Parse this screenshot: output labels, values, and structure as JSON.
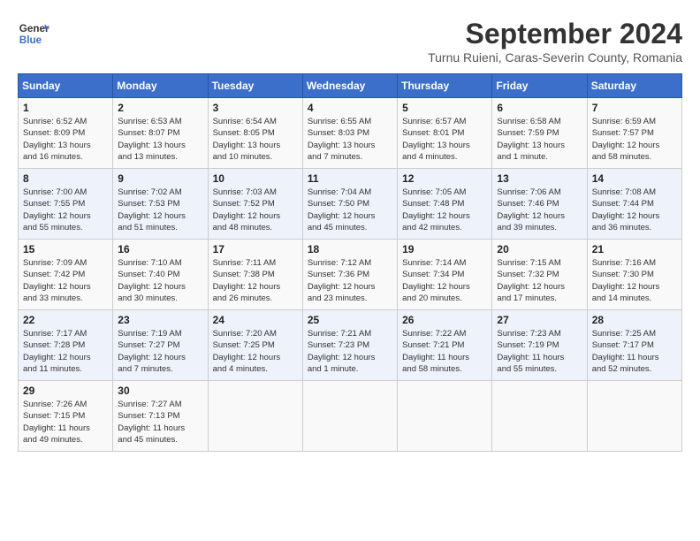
{
  "header": {
    "logo_line1": "General",
    "logo_line2": "Blue",
    "title": "September 2024",
    "subtitle": "Turnu Ruieni, Caras-Severin County, Romania"
  },
  "weekdays": [
    "Sunday",
    "Monday",
    "Tuesday",
    "Wednesday",
    "Thursday",
    "Friday",
    "Saturday"
  ],
  "weeks": [
    [
      {
        "day": "1",
        "info": "Sunrise: 6:52 AM\nSunset: 8:09 PM\nDaylight: 13 hours\nand 16 minutes."
      },
      {
        "day": "2",
        "info": "Sunrise: 6:53 AM\nSunset: 8:07 PM\nDaylight: 13 hours\nand 13 minutes."
      },
      {
        "day": "3",
        "info": "Sunrise: 6:54 AM\nSunset: 8:05 PM\nDaylight: 13 hours\nand 10 minutes."
      },
      {
        "day": "4",
        "info": "Sunrise: 6:55 AM\nSunset: 8:03 PM\nDaylight: 13 hours\nand 7 minutes."
      },
      {
        "day": "5",
        "info": "Sunrise: 6:57 AM\nSunset: 8:01 PM\nDaylight: 13 hours\nand 4 minutes."
      },
      {
        "day": "6",
        "info": "Sunrise: 6:58 AM\nSunset: 7:59 PM\nDaylight: 13 hours\nand 1 minute."
      },
      {
        "day": "7",
        "info": "Sunrise: 6:59 AM\nSunset: 7:57 PM\nDaylight: 12 hours\nand 58 minutes."
      }
    ],
    [
      {
        "day": "8",
        "info": "Sunrise: 7:00 AM\nSunset: 7:55 PM\nDaylight: 12 hours\nand 55 minutes."
      },
      {
        "day": "9",
        "info": "Sunrise: 7:02 AM\nSunset: 7:53 PM\nDaylight: 12 hours\nand 51 minutes."
      },
      {
        "day": "10",
        "info": "Sunrise: 7:03 AM\nSunset: 7:52 PM\nDaylight: 12 hours\nand 48 minutes."
      },
      {
        "day": "11",
        "info": "Sunrise: 7:04 AM\nSunset: 7:50 PM\nDaylight: 12 hours\nand 45 minutes."
      },
      {
        "day": "12",
        "info": "Sunrise: 7:05 AM\nSunset: 7:48 PM\nDaylight: 12 hours\nand 42 minutes."
      },
      {
        "day": "13",
        "info": "Sunrise: 7:06 AM\nSunset: 7:46 PM\nDaylight: 12 hours\nand 39 minutes."
      },
      {
        "day": "14",
        "info": "Sunrise: 7:08 AM\nSunset: 7:44 PM\nDaylight: 12 hours\nand 36 minutes."
      }
    ],
    [
      {
        "day": "15",
        "info": "Sunrise: 7:09 AM\nSunset: 7:42 PM\nDaylight: 12 hours\nand 33 minutes."
      },
      {
        "day": "16",
        "info": "Sunrise: 7:10 AM\nSunset: 7:40 PM\nDaylight: 12 hours\nand 30 minutes."
      },
      {
        "day": "17",
        "info": "Sunrise: 7:11 AM\nSunset: 7:38 PM\nDaylight: 12 hours\nand 26 minutes."
      },
      {
        "day": "18",
        "info": "Sunrise: 7:12 AM\nSunset: 7:36 PM\nDaylight: 12 hours\nand 23 minutes."
      },
      {
        "day": "19",
        "info": "Sunrise: 7:14 AM\nSunset: 7:34 PM\nDaylight: 12 hours\nand 20 minutes."
      },
      {
        "day": "20",
        "info": "Sunrise: 7:15 AM\nSunset: 7:32 PM\nDaylight: 12 hours\nand 17 minutes."
      },
      {
        "day": "21",
        "info": "Sunrise: 7:16 AM\nSunset: 7:30 PM\nDaylight: 12 hours\nand 14 minutes."
      }
    ],
    [
      {
        "day": "22",
        "info": "Sunrise: 7:17 AM\nSunset: 7:28 PM\nDaylight: 12 hours\nand 11 minutes."
      },
      {
        "day": "23",
        "info": "Sunrise: 7:19 AM\nSunset: 7:27 PM\nDaylight: 12 hours\nand 7 minutes."
      },
      {
        "day": "24",
        "info": "Sunrise: 7:20 AM\nSunset: 7:25 PM\nDaylight: 12 hours\nand 4 minutes."
      },
      {
        "day": "25",
        "info": "Sunrise: 7:21 AM\nSunset: 7:23 PM\nDaylight: 12 hours\nand 1 minute."
      },
      {
        "day": "26",
        "info": "Sunrise: 7:22 AM\nSunset: 7:21 PM\nDaylight: 11 hours\nand 58 minutes."
      },
      {
        "day": "27",
        "info": "Sunrise: 7:23 AM\nSunset: 7:19 PM\nDaylight: 11 hours\nand 55 minutes."
      },
      {
        "day": "28",
        "info": "Sunrise: 7:25 AM\nSunset: 7:17 PM\nDaylight: 11 hours\nand 52 minutes."
      }
    ],
    [
      {
        "day": "29",
        "info": "Sunrise: 7:26 AM\nSunset: 7:15 PM\nDaylight: 11 hours\nand 49 minutes."
      },
      {
        "day": "30",
        "info": "Sunrise: 7:27 AM\nSunset: 7:13 PM\nDaylight: 11 hours\nand 45 minutes."
      },
      {
        "day": "",
        "info": ""
      },
      {
        "day": "",
        "info": ""
      },
      {
        "day": "",
        "info": ""
      },
      {
        "day": "",
        "info": ""
      },
      {
        "day": "",
        "info": ""
      }
    ]
  ]
}
